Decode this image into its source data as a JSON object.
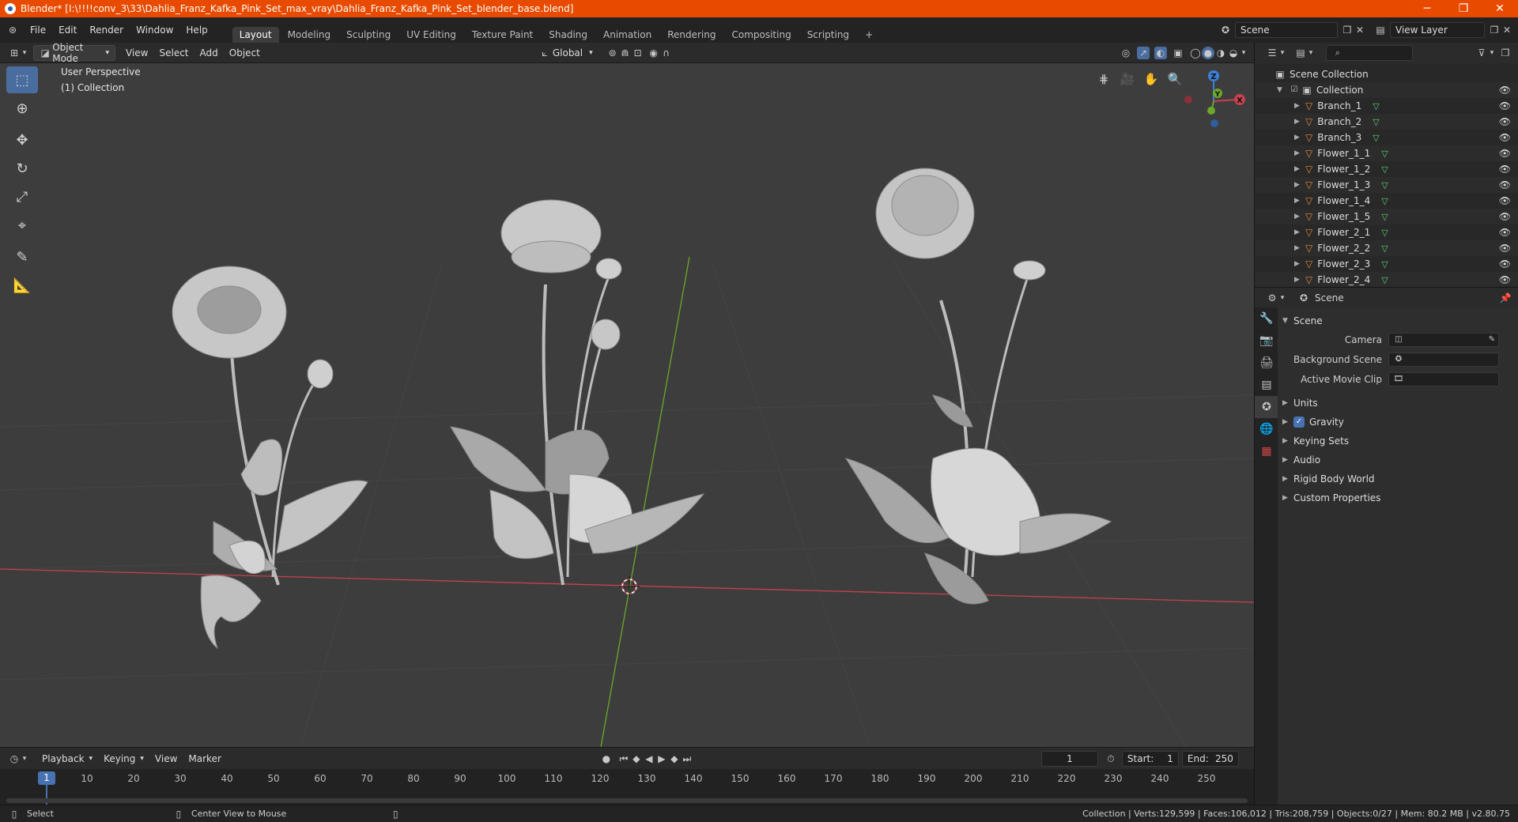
{
  "window": {
    "title": "Blender* [I:\\!!!!conv_3\\33\\Dahlia_Franz_Kafka_Pink_Set_max_vray\\Dahlia_Franz_Kafka_Pink_Set_blender_base.blend]",
    "minimize": "─",
    "maximize": "❐",
    "close": "✕"
  },
  "menu": {
    "items": [
      "File",
      "Edit",
      "Render",
      "Window",
      "Help"
    ],
    "workspaces": [
      "Layout",
      "Modeling",
      "Sculpting",
      "UV Editing",
      "Texture Paint",
      "Shading",
      "Animation",
      "Rendering",
      "Compositing",
      "Scripting"
    ],
    "add_tab": "+",
    "scene": "Scene",
    "view_layer": "View Layer"
  },
  "viewport_header": {
    "mode": "Object Mode",
    "menus": [
      "View",
      "Select",
      "Add",
      "Object"
    ],
    "transform": "Global"
  },
  "viewport": {
    "perspective": "User Perspective",
    "collection": "(1) Collection",
    "gizmo": {
      "z": "Z",
      "y": "Y",
      "x": "X"
    }
  },
  "timeline": {
    "menus": [
      "Playback",
      "Keying",
      "View",
      "Marker"
    ],
    "current_frame": "1",
    "start_label": "Start:",
    "start": "1",
    "end_label": "End:",
    "end": "250",
    "ticks": [
      "10",
      "20",
      "30",
      "40",
      "50",
      "60",
      "70",
      "80",
      "90",
      "100",
      "110",
      "120",
      "130",
      "140",
      "150",
      "160",
      "170",
      "180",
      "190",
      "200",
      "210",
      "220",
      "230",
      "240",
      "250"
    ],
    "cursor": "1"
  },
  "status": {
    "select": "Select",
    "center": "Center View to Mouse",
    "stats": "Collection | Verts:129,599 | Faces:106,012 | Tris:208,759 | Objects:0/27 | Mem: 80.2 MB | v2.80.75"
  },
  "outliner": {
    "root": "Scene Collection",
    "collection": "Collection",
    "items": [
      "Branch_1",
      "Branch_2",
      "Branch_3",
      "Flower_1_1",
      "Flower_1_2",
      "Flower_1_3",
      "Flower_1_4",
      "Flower_1_5",
      "Flower_2_1",
      "Flower_2_2",
      "Flower_2_3",
      "Flower_2_4"
    ]
  },
  "properties": {
    "context": "Scene",
    "section": "Scene",
    "fields": [
      {
        "label": "Camera",
        "value": ""
      },
      {
        "label": "Background Scene",
        "value": ""
      },
      {
        "label": "Active Movie Clip",
        "value": ""
      }
    ],
    "panels": [
      "Units",
      "Gravity",
      "Keying Sets",
      "Audio",
      "Rigid Body World",
      "Custom Properties"
    ]
  },
  "colors": {
    "titlebar": "#e84a00",
    "accent": "#4772b3",
    "x_axis": "#c8414e",
    "y_axis": "#6ca829",
    "z_axis": "#3d7fd6"
  }
}
